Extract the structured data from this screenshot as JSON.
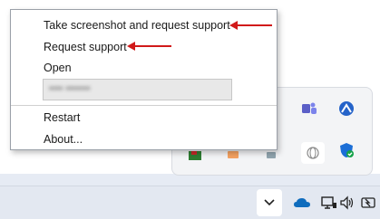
{
  "menu": {
    "items": [
      {
        "label": "Take screenshot and request support"
      },
      {
        "label": "Request support"
      },
      {
        "label": "Open"
      },
      {
        "label": "Restart"
      },
      {
        "label": "About..."
      }
    ],
    "field_value": "•••• •••••••"
  },
  "colors": {
    "annotation_arrow": "#d11a1a",
    "accent_blue": "#0f6cbd",
    "shield_blue": "#1b6ed6",
    "badge_green": "#16a34a"
  },
  "tray_icons": [
    "teams-icon",
    "vpn-icon",
    "colored-app-icon",
    "orange-app-icon",
    "globe-icon",
    "security-shield-icon"
  ],
  "taskbar_icons": [
    "chevron-up-icon",
    "onedrive-cloud-icon",
    "network-monitor-icon",
    "speaker-icon",
    "battery-icon"
  ]
}
